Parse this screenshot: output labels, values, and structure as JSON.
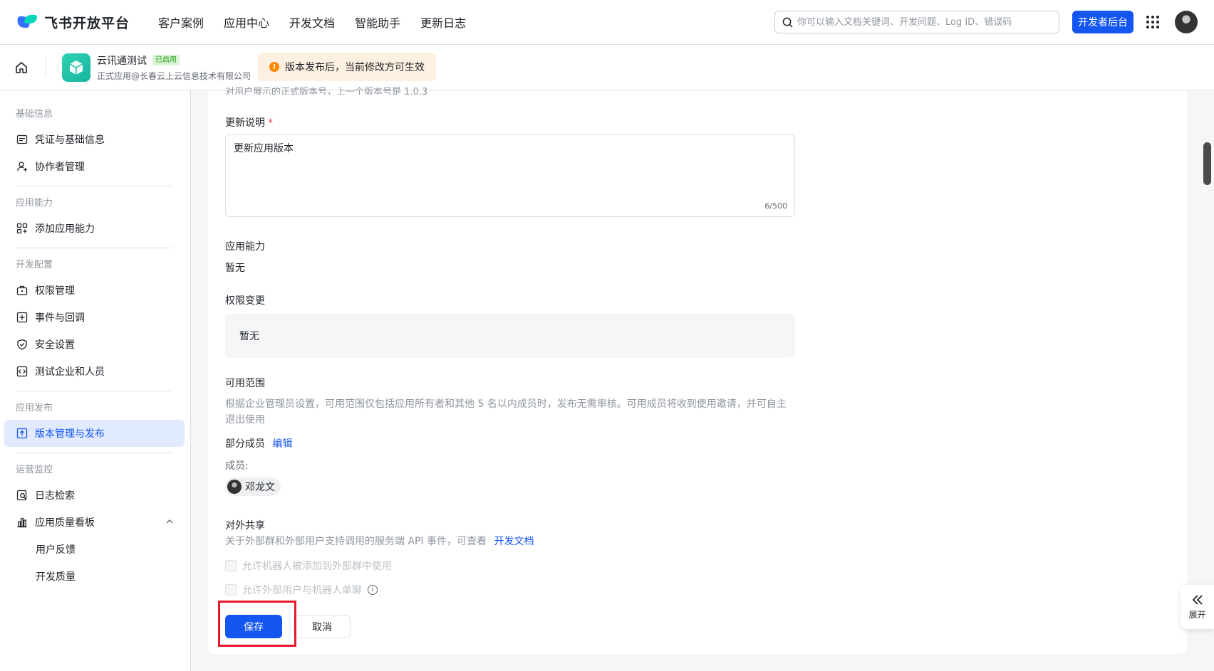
{
  "topnav": {
    "logo_text": "飞书开放平台",
    "links": [
      "客户案例",
      "应用中心",
      "开发文档",
      "智能助手",
      "更新日志"
    ],
    "search_placeholder": "你可以输入文档关键词、开发问题、Log ID、错误码",
    "dev_console_label": "开发者后台"
  },
  "app": {
    "name": "云讯通测试",
    "status_badge": "已启用",
    "org": "正式应用@长春云上云信息技术有限公司",
    "notice": "版本发布后，当前修改方可生效"
  },
  "sidebar": {
    "groups": [
      {
        "title": "基础信息",
        "items": [
          "凭证与基础信息",
          "协作者管理"
        ]
      },
      {
        "title": "应用能力",
        "items": [
          "添加应用能力"
        ]
      },
      {
        "title": "开发配置",
        "items": [
          "权限管理",
          "事件与回调",
          "安全设置",
          "测试企业和人员"
        ]
      },
      {
        "title": "应用发布",
        "items": [
          "版本管理与发布"
        ]
      },
      {
        "title": "运营监控",
        "items": [
          "日志检索",
          "应用质量看板",
          "用户反馈",
          "开发质量"
        ]
      }
    ]
  },
  "form": {
    "clipped_hint": "对用户展示的正式版本号，上一个版本号是 1.0.3",
    "update_notes_label": "更新说明",
    "required_mark": "*",
    "update_notes_value": "更新应用版本",
    "char_counter": "6/500",
    "capability_label": "应用能力",
    "capability_value": "暂无",
    "permission_label": "权限变更",
    "permission_value": "暂无",
    "scope_label": "可用范围",
    "scope_desc": "根据企业管理员设置，可用范围仅包括应用所有者和其他 5 名以内成员时，发布无需审核。可用成员将收到使用邀请，并可自主退出使用",
    "scope_value": "部分成员",
    "scope_edit": "编辑",
    "members_label": "成员:",
    "member_name": "邓龙文",
    "share_label": "对外共享",
    "share_desc": "关于外部群和外部用户支持调用的服务端 API 事件，可查看",
    "share_link": "开发文档",
    "check_group": "允许机器人被添加到外部群中使用",
    "check_chat": "允许外部用户与机器人单聊",
    "save": "保存",
    "cancel": "取消"
  },
  "expand_label": "展开",
  "colors": {
    "accent": "#1456f0",
    "highlight": "#e8182c",
    "notice_bg": "#fef0e1",
    "warn": "#ff8800"
  }
}
